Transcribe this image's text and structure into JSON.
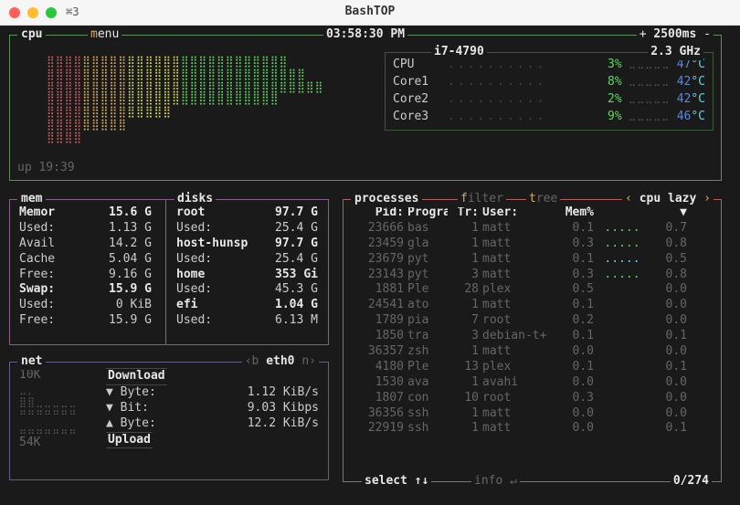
{
  "window": {
    "title": "BashTOP",
    "tabicon": "⌘3"
  },
  "cpu": {
    "label": "cpu",
    "menu_label": "enu",
    "menu_u": "m",
    "time": "03:58:30 PM",
    "update_prefix": "+ ",
    "update": "2500ms",
    "update_suffix": " -",
    "model": "i7-4790",
    "freq": "2.3 GHz",
    "uptime": "up 19:39",
    "cores": [
      {
        "name": "CPU",
        "pct": "3%",
        "temp": "47",
        "unit": "°C"
      },
      {
        "name": "Core1",
        "pct": "8%",
        "temp": "42",
        "unit": "°C"
      },
      {
        "name": "Core2",
        "pct": "2%",
        "temp": "42",
        "unit": "°C"
      },
      {
        "name": "Core3",
        "pct": "9%",
        "temp": "46",
        "unit": "°C"
      }
    ]
  },
  "mem": {
    "label": "mem",
    "rows": [
      {
        "k": "Memor",
        "v": "15.6 G",
        "b": true
      },
      {
        "k": "Used:",
        "v": "1.13 G"
      },
      {
        "k": "Avail",
        "v": "14.2 G"
      },
      {
        "k": "Cache",
        "v": "5.04 G"
      },
      {
        "k": "Free:",
        "v": "9.16 G"
      },
      {
        "k": "Swap:",
        "v": "15.9 G",
        "b": true
      },
      {
        "k": "Used:",
        "v": "0 KiB"
      },
      {
        "k": "Free:",
        "v": "15.9 G"
      }
    ]
  },
  "disks": {
    "label": "disks",
    "rows": [
      {
        "k": "root",
        "v": "97.7 G",
        "b": true
      },
      {
        "k": "Used:",
        "v": "25.4 G"
      },
      {
        "k": "host-hunsp",
        "v": "97.7 G",
        "b": true
      },
      {
        "k": "Used:",
        "v": "25.4 G"
      },
      {
        "k": "home",
        "v": "353 Gi",
        "b": true
      },
      {
        "k": "Used:",
        "v": "45.3 G"
      },
      {
        "k": "efi",
        "v": "1.04 G",
        "b": true
      },
      {
        "k": "Used:",
        "v": "6.13 M"
      }
    ]
  },
  "net": {
    "label": "net",
    "iface_prefix": "‹b ",
    "iface": "eth0",
    "iface_suffix": " n›",
    "top": "10K",
    "bot": "54K",
    "dl_label": "Download",
    "ul_label": "Upload",
    "rows": [
      {
        "sym": "▼",
        "k": "Byte:",
        "v": "1.12 KiB/s"
      },
      {
        "sym": "▼",
        "k": "Bit:",
        "v": "9.03 Kibps"
      },
      {
        "sym": "▲",
        "k": "Byte:",
        "v": "12.2 KiB/s"
      }
    ]
  },
  "proc": {
    "label": "processes",
    "filter": "ilter",
    "filter_u": "f",
    "tree": "ree",
    "tree_u": "t",
    "sort_prefix": "‹ ",
    "sort": "cpu lazy",
    "sort_suffix": " ›",
    "cols": {
      "pid": "Pid:",
      "prog": "Program:",
      "thr": "Tr:",
      "user": "User:",
      "mem": "Mem%",
      "arrow": "▼"
    },
    "select": "select ↑↓",
    "info": "info ↵",
    "pos": "0/274",
    "rows": [
      {
        "pid": "23666",
        "prog": "bas",
        "thr": "1",
        "user": "matt",
        "mem": "0.1",
        "bar": ".....",
        "cpu": "0.7",
        "c": "green"
      },
      {
        "pid": "23459",
        "prog": "gla",
        "thr": "1",
        "user": "matt",
        "mem": "0.3",
        "bar": ".....",
        "cpu": "0.8",
        "c": "green"
      },
      {
        "pid": "23679",
        "prog": "pyt",
        "thr": "1",
        "user": "matt",
        "mem": "0.1",
        "bar": ".....",
        "cpu": "0.5",
        "c": "cyan"
      },
      {
        "pid": "23143",
        "prog": "pyt",
        "thr": "3",
        "user": "matt",
        "mem": "0.3",
        "bar": ".....",
        "cpu": "0.8",
        "c": "green"
      },
      {
        "pid": "1881",
        "prog": "Ple",
        "thr": "28",
        "user": "plex",
        "mem": "0.5",
        "bar": "",
        "cpu": "0.0"
      },
      {
        "pid": "24541",
        "prog": "ato",
        "thr": "1",
        "user": "matt",
        "mem": "0.1",
        "bar": "",
        "cpu": "0.0"
      },
      {
        "pid": "1789",
        "prog": "pia",
        "thr": "7",
        "user": "root",
        "mem": "0.2",
        "bar": "",
        "cpu": "0.0"
      },
      {
        "pid": "1850",
        "prog": "tra",
        "thr": "3",
        "user": "debian-t+",
        "mem": "0.1",
        "bar": "",
        "cpu": "0.1"
      },
      {
        "pid": "36357",
        "prog": "zsh",
        "thr": "1",
        "user": "matt",
        "mem": "0.0",
        "bar": "",
        "cpu": "0.0"
      },
      {
        "pid": "4180",
        "prog": "Ple",
        "thr": "13",
        "user": "plex",
        "mem": "0.1",
        "bar": "",
        "cpu": "0.1"
      },
      {
        "pid": "1530",
        "prog": "ava",
        "thr": "1",
        "user": "avahi",
        "mem": "0.0",
        "bar": "",
        "cpu": "0.0"
      },
      {
        "pid": "1807",
        "prog": "con",
        "thr": "10",
        "user": "root",
        "mem": "0.3",
        "bar": "",
        "cpu": "0.0"
      },
      {
        "pid": "36356",
        "prog": "ssh",
        "thr": "1",
        "user": "matt",
        "mem": "0.0",
        "bar": "",
        "cpu": "0.0"
      },
      {
        "pid": "22919",
        "prog": "ssh",
        "thr": "1",
        "user": "matt",
        "mem": "0.0",
        "bar": "",
        "cpu": "0.1"
      }
    ]
  }
}
